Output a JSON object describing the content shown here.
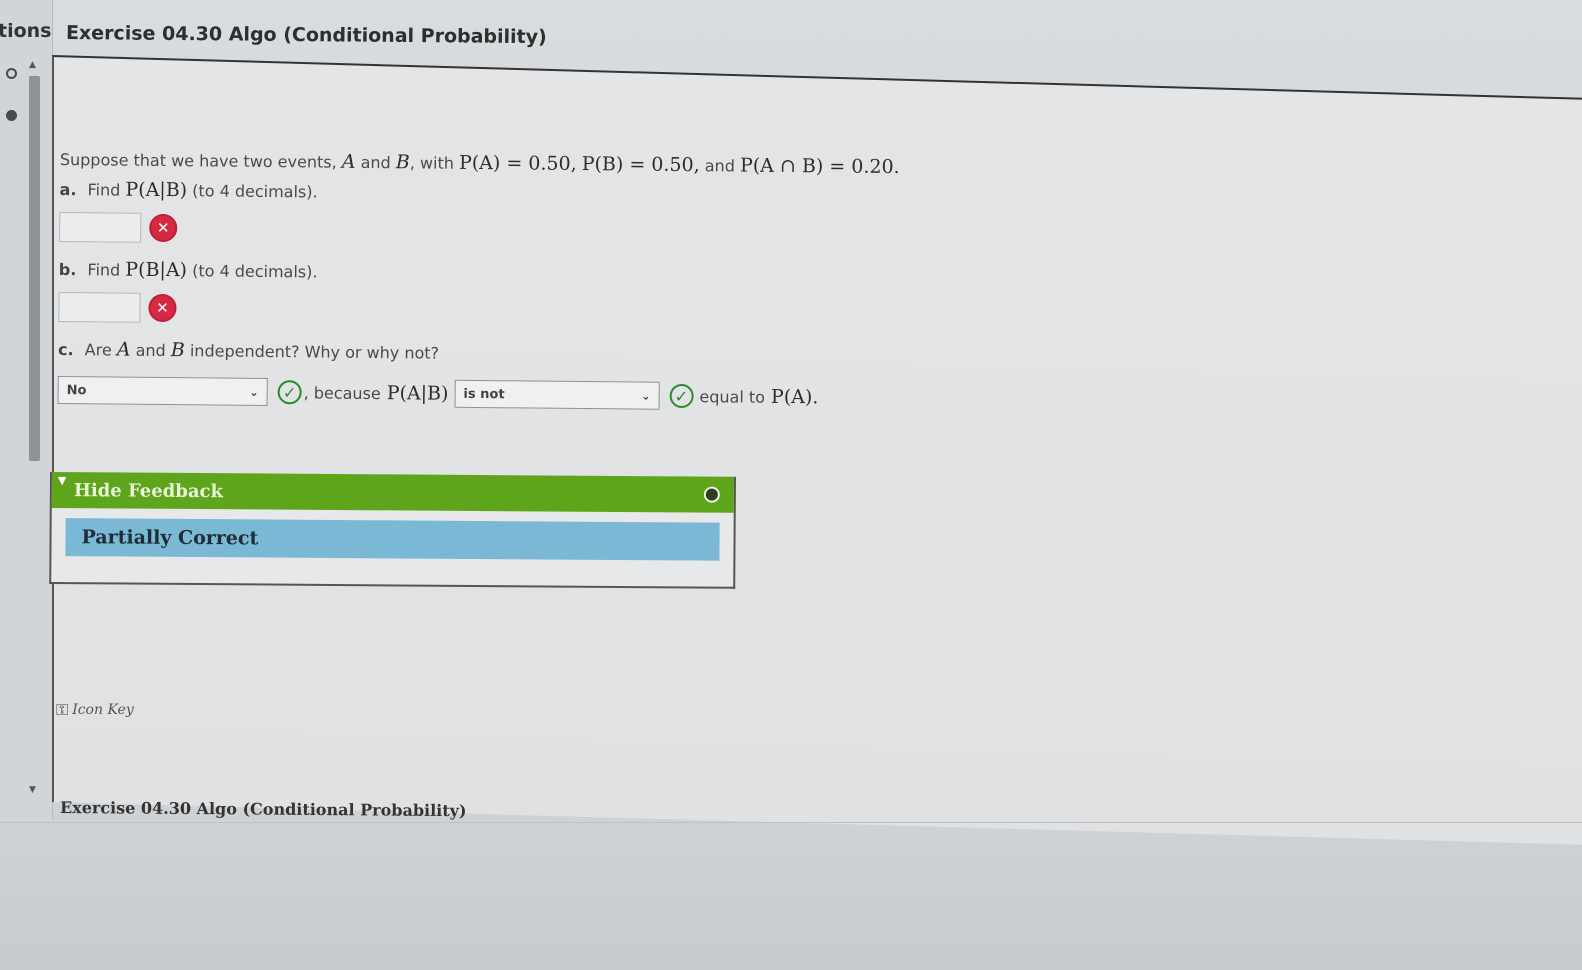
{
  "sidebar": {
    "tab_label": "tions"
  },
  "header": {
    "title": "Exercise 04.30 Algo (Conditional Probability)"
  },
  "question": {
    "intro_text": "Suppose that we have two events,",
    "event_a": "A",
    "and_word": "and",
    "event_b": "B",
    "with_word": ", with",
    "pa": "P(A) = 0.50,",
    "pb": "P(B) = 0.50,",
    "and_word2": "and",
    "pab": "P(A ∩ B) = 0.20.",
    "a": {
      "label": "a.",
      "text_before": "Find",
      "math": "P(A|B)",
      "text_after": "(to 4 decimals).",
      "value": ""
    },
    "b": {
      "label": "b.",
      "text_before": "Find",
      "math": "P(B|A)",
      "text_after": "(to 4 decimals).",
      "value": ""
    },
    "c": {
      "label": "c.",
      "text": "Are",
      "event_a": "A",
      "and_word": "and",
      "event_b": "B",
      "text_after": "independent? Why or why not?",
      "select1_value": "No",
      "because_text": ", because",
      "because_math": "P(A|B)",
      "select2_value": "is not",
      "equal_text": "equal to",
      "equal_math": "P(A)."
    }
  },
  "feedback": {
    "toggle_label": "Hide Feedback",
    "result": "Partially Correct"
  },
  "icon_key": {
    "label": "Icon Key"
  },
  "footer": {
    "title": "Exercise 04.30 Algo (Conditional Probability)"
  },
  "colors": {
    "feedback_header": "#5fa51c",
    "feedback_result": "#7ab8d6",
    "incorrect": "#d42a44",
    "correct": "#2b8a2b"
  }
}
